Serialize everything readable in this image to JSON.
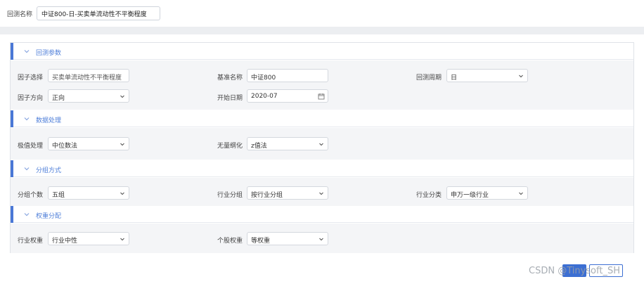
{
  "header": {
    "backtest_name_label": "回测名称",
    "backtest_name_value": "中证800-日-买卖单流动性不平衡程度"
  },
  "sections": [
    {
      "title": "回测参数",
      "fields": [
        {
          "label": "因子选择",
          "value": "买卖单流动性不平衡程度",
          "kind": "text"
        },
        {
          "label": "基准名称",
          "value": "中证800",
          "kind": "text"
        },
        {
          "label": "回测周期",
          "value": "日",
          "kind": "select"
        },
        {
          "label": "因子方向",
          "value": "正向",
          "kind": "select"
        },
        {
          "label": "开始日期",
          "value": "2020-07",
          "kind": "date"
        }
      ]
    },
    {
      "title": "数据处理",
      "fields": [
        {
          "label": "极值处理",
          "value": "中位数法",
          "kind": "select"
        },
        {
          "label": "无量纲化",
          "value": "z值法",
          "kind": "select"
        }
      ]
    },
    {
      "title": "分组方式",
      "fields": [
        {
          "label": "分组个数",
          "value": "五组",
          "kind": "select"
        },
        {
          "label": "行业分组",
          "value": "按行业分组",
          "kind": "select"
        },
        {
          "label": "行业分类",
          "value": "申万一级行业",
          "kind": "select"
        }
      ]
    },
    {
      "title": "权重分配",
      "fields": [
        {
          "label": "行业权重",
          "value": "行业中性",
          "kind": "select"
        },
        {
          "label": "个股权重",
          "value": "等权重",
          "kind": "select"
        }
      ]
    }
  ],
  "watermark": "CSDN @Tinysoft_SH",
  "colors": {
    "accent": "#4a78d6",
    "section_title": "#4f7fd9",
    "section_body_bg": "#f4f5f7"
  },
  "icons": {
    "section_toggle": "chevron-down-icon",
    "select_caret": "chevron-down-icon",
    "date_picker": "calendar-icon"
  }
}
